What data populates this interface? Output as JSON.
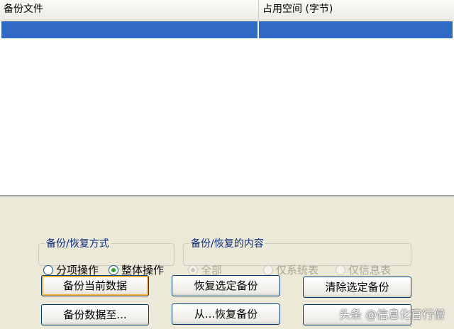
{
  "list": {
    "columns": [
      "备份文件",
      "占用空间 (字节)"
    ],
    "selected_row": [
      "",
      ""
    ]
  },
  "mode_group": {
    "title": "备份/恢复方式",
    "options": [
      {
        "label": "分项操作",
        "selected": false
      },
      {
        "label": "整体操作",
        "selected": true
      }
    ]
  },
  "content_group": {
    "title": "备份/恢复的内容",
    "options": [
      {
        "label": "全部",
        "selected": true,
        "enabled": false
      },
      {
        "label": "仅系统表",
        "selected": false,
        "enabled": false
      },
      {
        "label": "仅信息表",
        "selected": false,
        "enabled": false
      }
    ]
  },
  "buttons": {
    "backup_current": "备份当前数据",
    "restore_selected": "恢复选定备份",
    "clear_selected": "清除选定备份",
    "backup_to": "备份数据至...",
    "restore_from": "从...恢复备份",
    "extra": ""
  },
  "watermark": "头条 @信息化官行僧",
  "colors": {
    "selection": "#316ac5",
    "window_bg": "#ece9d8",
    "group_title": "#0a2a7a"
  }
}
